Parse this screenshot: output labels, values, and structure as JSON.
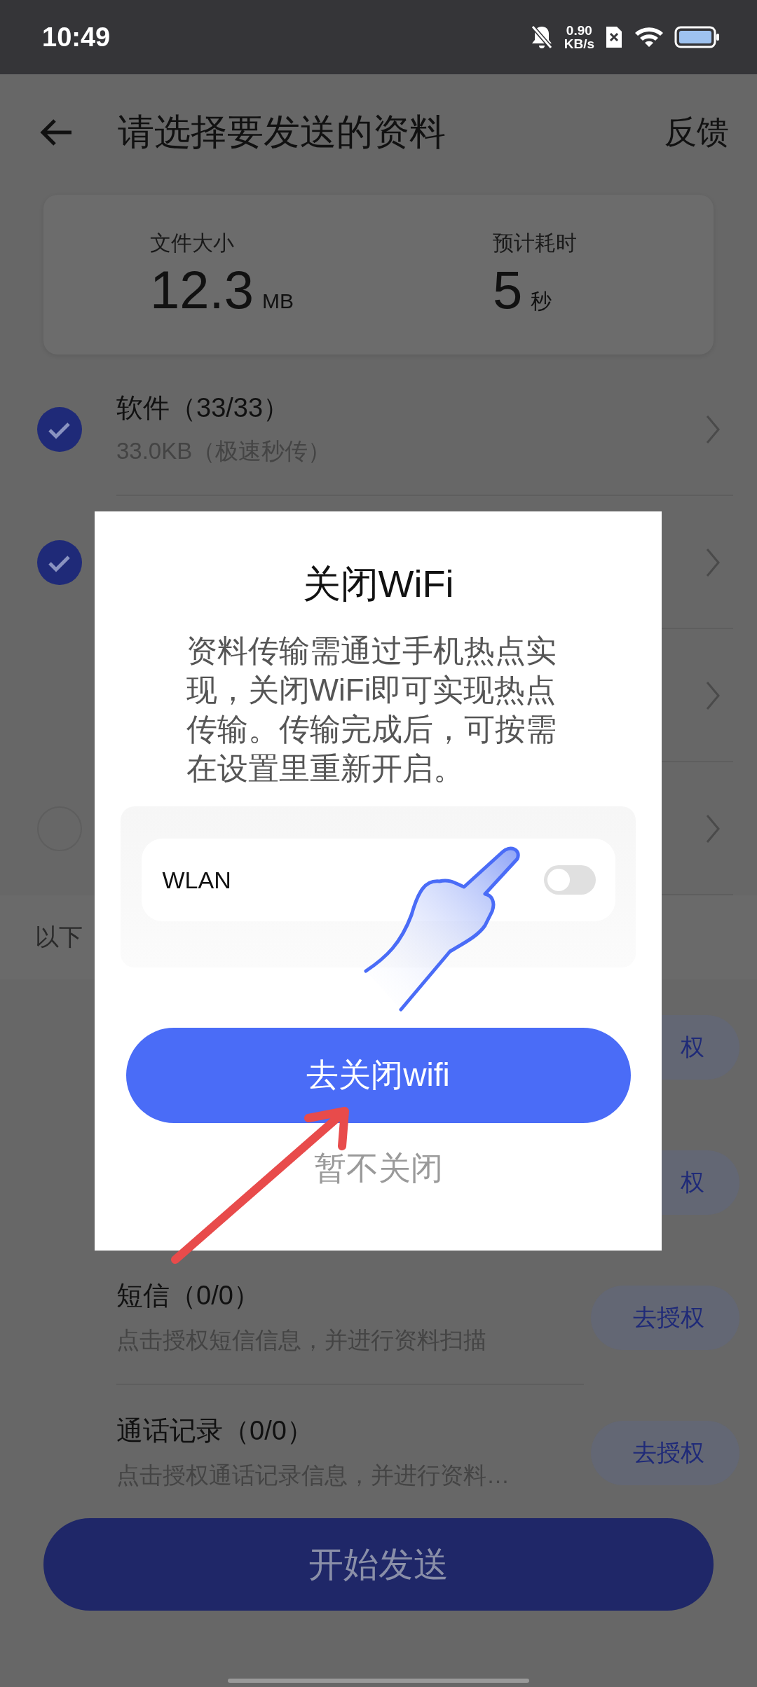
{
  "status_bar": {
    "time": "10:49",
    "net_speed": "0.90",
    "net_unit": "KB/s"
  },
  "header": {
    "title": "请选择要发送的资料",
    "action": "反馈"
  },
  "summary": [
    {
      "label": "文件大小",
      "value": "12.3",
      "unit": "MB"
    },
    {
      "label": "预计耗时",
      "value": "5",
      "unit": "秒"
    }
  ],
  "items": [
    {
      "kind": "checkbox",
      "checked": true,
      "title": "软件（33/33）",
      "subtitle": "33.0KB（极速秒传）"
    },
    {
      "kind": "checkbox",
      "checked": true
    },
    {
      "kind": "plain"
    },
    {
      "kind": "checkbox",
      "checked": false
    }
  ],
  "section_label": "以下",
  "permissions": [
    {
      "button": "权"
    },
    {
      "button": "权"
    },
    {
      "title": "短信（0/0）",
      "subtitle": "点击授权短信信息，并进行资料扫描",
      "button": "去授权"
    },
    {
      "title": "通话记录（0/0）",
      "subtitle": "点击授权通话记录信息，并进行资料…",
      "button": "去授权"
    }
  ],
  "start_button": "开始发送",
  "dialog": {
    "title": "关闭WiFi",
    "message": "资料传输需通过手机热点实现，关闭WiFi即可实现热点传输。传输完成后，可按需在设置里重新开启。",
    "toggle": {
      "label": "WLAN",
      "on": false
    },
    "primary_button": "去关闭wifi",
    "secondary_button": "暂不关闭"
  }
}
